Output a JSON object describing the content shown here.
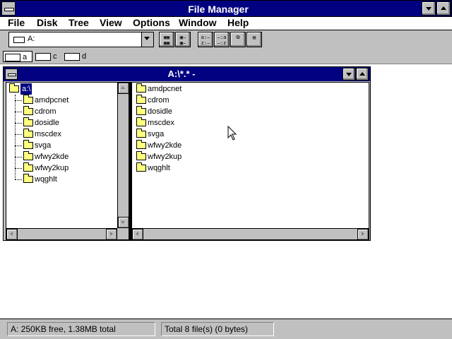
{
  "window": {
    "title": "File Manager"
  },
  "menu": [
    "File",
    "Disk",
    "Tree",
    "View",
    "Options",
    "Window",
    "Help"
  ],
  "toolbar": {
    "drive_value": "A:",
    "buttons": [
      "B:B: B:B:",
      "B:— B:—",
      "a:— z:—",
      "—:a —:z",
      "copy",
      "props"
    ]
  },
  "drives": [
    {
      "letter": "a",
      "selected": true
    },
    {
      "letter": "c",
      "selected": false
    },
    {
      "letter": "d",
      "selected": false
    }
  ],
  "child": {
    "title": "A:\\*.* -",
    "tree": {
      "root": "a:\\",
      "folders": [
        "amdpcnet",
        "cdrom",
        "dosidle",
        "mscdex",
        "svga",
        "wfwy2kde",
        "wfwy2kup",
        "wqghlt"
      ]
    },
    "files": [
      "amdpcnet",
      "cdrom",
      "dosidle",
      "mscdex",
      "svga",
      "wfwy2kde",
      "wfwy2kup",
      "wqghlt"
    ]
  },
  "status": {
    "left": "A: 250KB free,  1.38MB total",
    "right": "Total 8 file(s) (0 bytes)"
  },
  "colors": {
    "titlebar": "#000080",
    "face": "#c0c0c0",
    "folder": "#ffff80"
  }
}
